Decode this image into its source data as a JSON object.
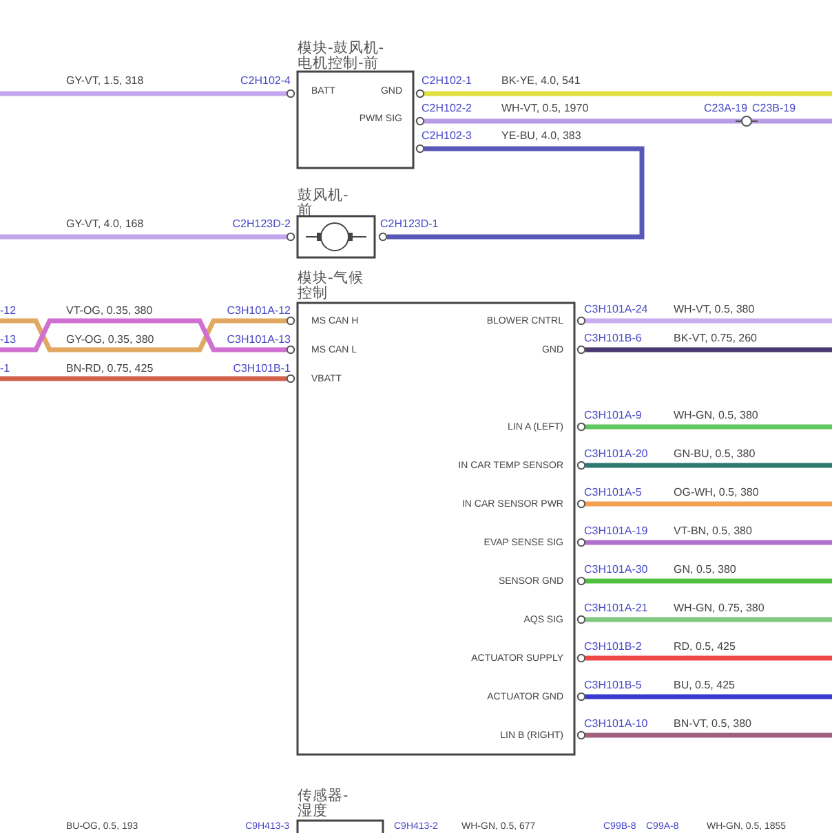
{
  "blower_control_module": {
    "title": [
      "模块-鼓风机-",
      "电机控制-前"
    ],
    "pins": [
      {
        "label": "BATT"
      },
      {
        "label": "GND"
      },
      {
        "label": "PWM SIG"
      }
    ],
    "left_wire": {
      "connector": "C2H102-4",
      "spec": "GY-VT, 1.5, 318",
      "color": "#c3a6ec"
    },
    "right_wires": [
      {
        "connector": "C2H102-1",
        "spec": "BK-YE, 4.0, 541",
        "color": "#e0e040"
      },
      {
        "connector": "C2H102-2",
        "spec": "WH-VT, 0.5, 1970",
        "color": "#b99ce6",
        "inline_connectors": [
          "C23A-19",
          "C23B-19"
        ]
      },
      {
        "connector": "C2H102-3",
        "spec": "YE-BU, 4.0, 383",
        "color": "#5858b8"
      }
    ]
  },
  "blower_motor": {
    "title": [
      "鼓风机-",
      "前"
    ],
    "left_wire": {
      "connector": "C2H123D-2",
      "spec": "GY-VT, 4.0, 168",
      "color": "#c3a6ec"
    },
    "right_connector": "C2H123D-1"
  },
  "climate_control_module": {
    "title": [
      "模块-气候",
      "控制"
    ],
    "left_pins": [
      {
        "label": "MS CAN H",
        "connector": "C3H101A-12",
        "cut_connector": "-12",
        "spec": "VT-OG, 0.35, 380",
        "color": "#e0a860"
      },
      {
        "label": "MS CAN L",
        "connector": "C3H101A-13",
        "cut_connector": "-13",
        "spec": "GY-OG, 0.35, 380",
        "color": "#d070d0"
      },
      {
        "label": "VBATT",
        "connector": "C3H101B-1",
        "cut_connector": "-1",
        "spec": "BN-RD, 0.75, 425",
        "color": "#d0604a"
      }
    ],
    "right_pins": [
      {
        "label": "BLOWER CNTRL",
        "connector": "C3H101A-24",
        "spec": "WH-VT, 0.5, 380",
        "color": "#c8aef0"
      },
      {
        "label": "GND",
        "connector": "C3H101B-6",
        "spec": "BK-VT, 0.75, 260",
        "color": "#4a3a70"
      },
      {
        "label": "LIN A (LEFT)",
        "connector": "C3H101A-9",
        "spec": "WH-GN, 0.5, 380",
        "color": "#60c860"
      },
      {
        "label": "IN CAR TEMP SENSOR",
        "connector": "C3H101A-20",
        "spec": "GN-BU, 0.5, 380",
        "color": "#2f7a70"
      },
      {
        "label": "IN CAR SENSOR PWR",
        "connector": "C3H101A-5",
        "spec": "OG-WH, 0.5, 380",
        "color": "#f5a050"
      },
      {
        "label": "EVAP SENSE SIG",
        "connector": "C3H101A-19",
        "spec": "VT-BN, 0.5, 380",
        "color": "#b070d0"
      },
      {
        "label": "SENSOR GND",
        "connector": "C3H101A-30",
        "spec": "GN, 0.5, 380",
        "color": "#50c040"
      },
      {
        "label": "AQS SIG",
        "connector": "C3H101A-21",
        "spec": "WH-GN, 0.75, 380",
        "color": "#80c880"
      },
      {
        "label": "ACTUATOR SUPPLY",
        "connector": "C3H101B-2",
        "spec": "RD, 0.5, 425",
        "color": "#f04848"
      },
      {
        "label": "ACTUATOR GND",
        "connector": "C3H101B-5",
        "spec": "BU, 0.5, 425",
        "color": "#3a3ad0"
      },
      {
        "label": "LIN B (RIGHT)",
        "connector": "C3H101A-10",
        "spec": "BN-VT, 0.5, 380",
        "color": "#a06080"
      }
    ]
  },
  "humidity_sensor": {
    "title": [
      "传感器-",
      "湿度"
    ],
    "left_wire": {
      "connector": "C9H413-3",
      "spec": "BU-OG, 0.5, 193"
    },
    "right_wire": {
      "connector": "C9H413-2",
      "spec": "WH-GN, 0.5, 677",
      "inline_connectors": [
        "C99B-8",
        "C99A-8"
      ],
      "spec_after": "WH-GN, 0.5, 1855"
    }
  }
}
